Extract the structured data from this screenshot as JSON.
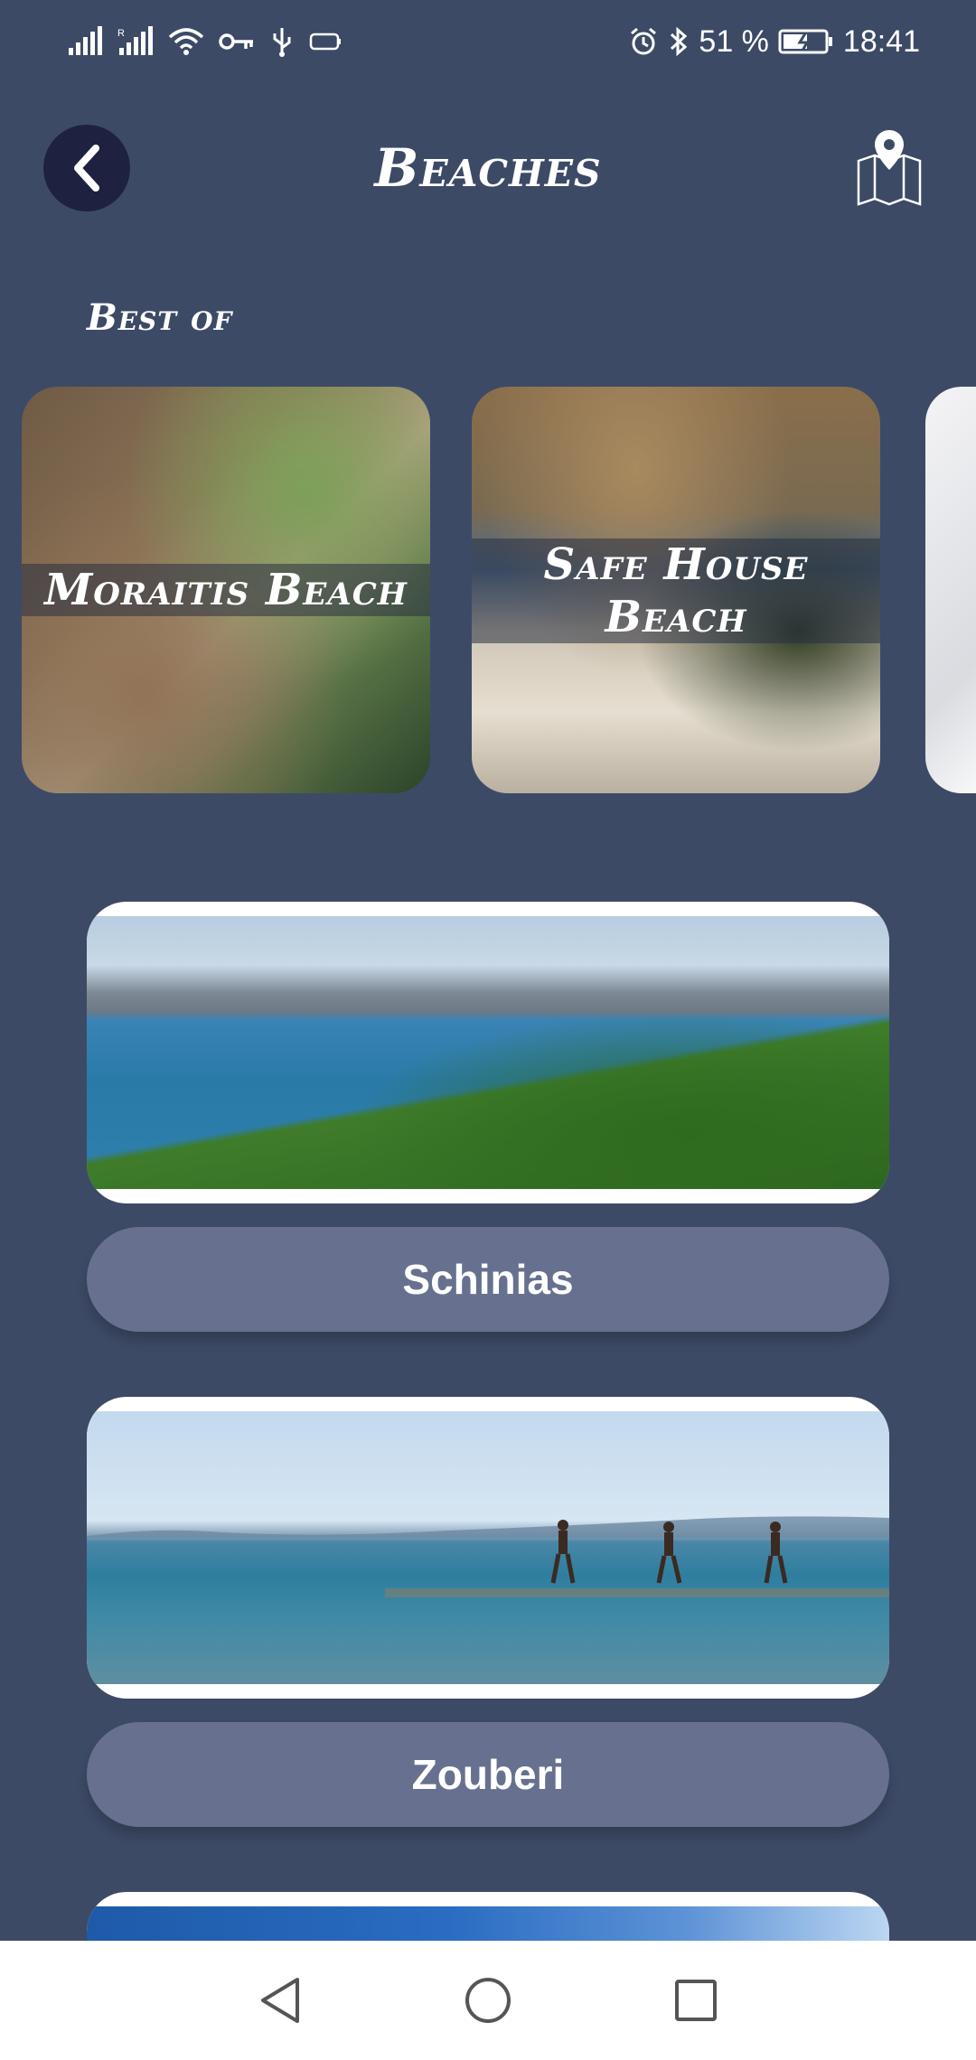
{
  "status_bar": {
    "battery_percent": "51 %",
    "time": "18:41"
  },
  "header": {
    "title": "Beaches"
  },
  "best_of": {
    "title": "Best of",
    "cards": [
      {
        "label": "Moraitis Beach"
      },
      {
        "label": "Safe House Beach"
      },
      {
        "label": ""
      }
    ]
  },
  "beaches": [
    {
      "name": "Schinias"
    },
    {
      "name": "Zouberi"
    }
  ],
  "colors": {
    "background": "#3d4a66",
    "back_button": "#1e2240",
    "beach_button": "#67718f",
    "nav_bar": "#ffffff"
  },
  "icons": {
    "back": "chevron-left-icon",
    "map": "map-pin-icon",
    "nav_back": "triangle-back-icon",
    "nav_home": "circle-home-icon",
    "nav_recent": "square-recent-icon"
  }
}
